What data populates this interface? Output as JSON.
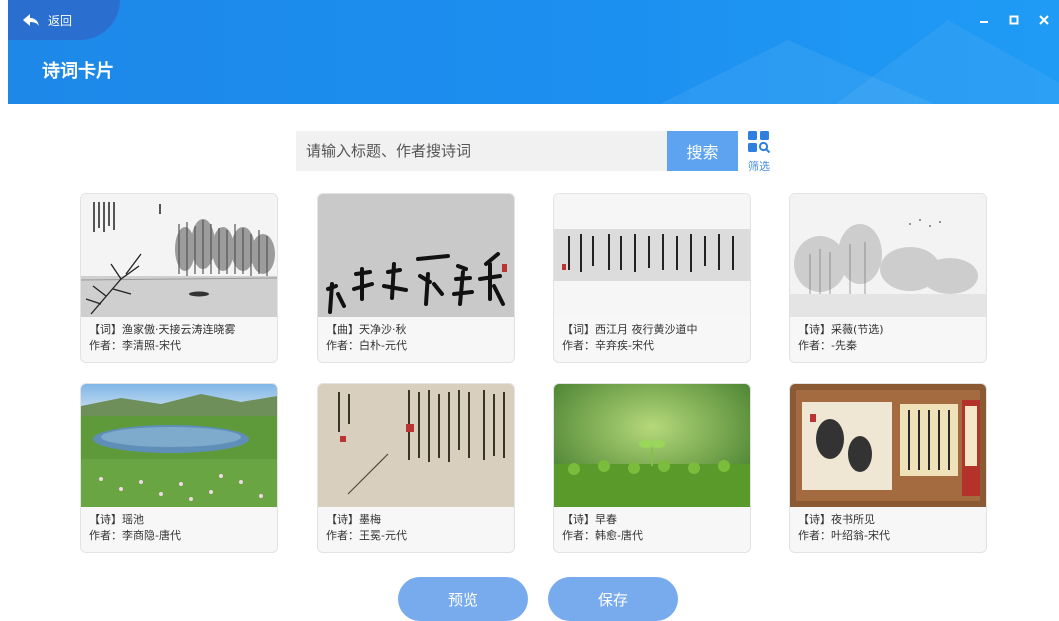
{
  "header": {
    "back_label": "返回",
    "title": "诗词卡片",
    "accent": "#1d88e8"
  },
  "search": {
    "placeholder": "请输入标题、作者搜诗词",
    "button_label": "搜索",
    "filter_label": "筛选"
  },
  "cards": [
    {
      "title": "【词】渔家傲·天接云涛连晓雾",
      "author": "作者：李清照-宋代",
      "image": "ink-lake-trees"
    },
    {
      "title": "【曲】天净沙·秋",
      "author": "作者：白朴-元代",
      "image": "calligraphy-large"
    },
    {
      "title": "【词】西江月 夜行黄沙道中",
      "author": "作者：辛弃疾-宋代",
      "image": "calligraphy-scroll"
    },
    {
      "title": "【诗】采薇(节选)",
      "author": "作者：-先秦",
      "image": "ink-mountains"
    },
    {
      "title": "【诗】瑶池",
      "author": "作者：李商隐-唐代",
      "image": "lake-flowers"
    },
    {
      "title": "【诗】墨梅",
      "author": "作者：王冕-元代",
      "image": "calligraphy-plum"
    },
    {
      "title": "【诗】早春",
      "author": "作者：韩愈-唐代",
      "image": "green-sprout"
    },
    {
      "title": "【诗】夜书所见",
      "author": "作者：叶绍翁-宋代",
      "image": "painting-night"
    }
  ],
  "actions": {
    "preview_label": "预览",
    "save_label": "保存"
  }
}
